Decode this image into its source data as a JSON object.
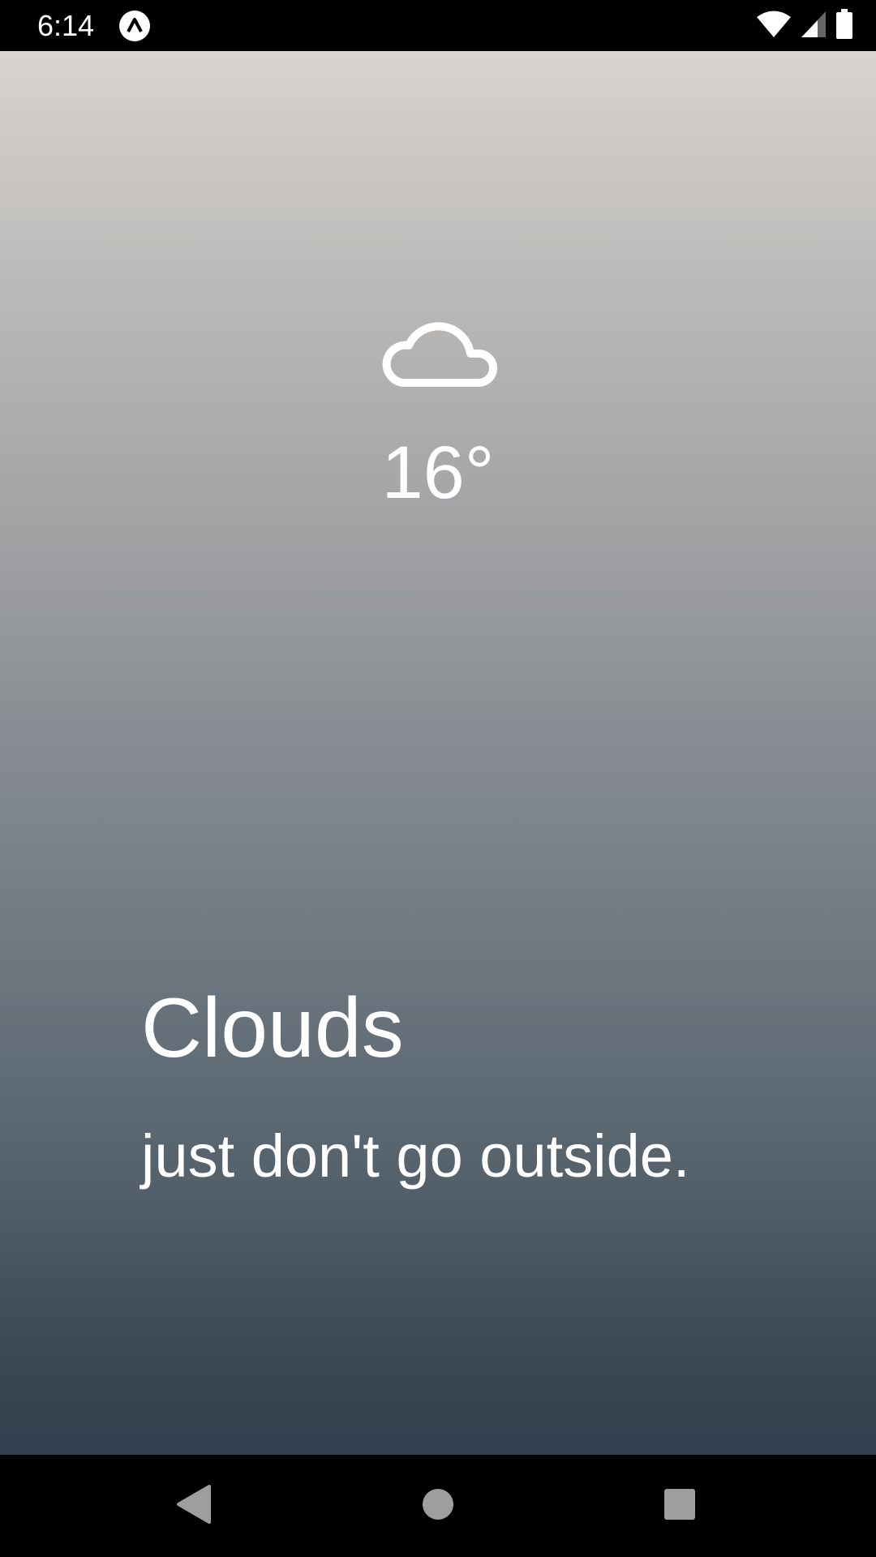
{
  "status_bar": {
    "time": "6:14",
    "icons": [
      "app-notification-icon",
      "wifi-icon",
      "signal-icon",
      "battery-icon"
    ]
  },
  "weather": {
    "icon": "cloud-icon",
    "temperature": "16°",
    "condition": "Clouds",
    "message": "just don't go outside."
  },
  "nav_bar": {
    "buttons": [
      "back-icon",
      "home-icon",
      "recents-icon"
    ]
  },
  "colors": {
    "gradient_top": "#d8d4cf",
    "gradient_bottom": "#303f4d",
    "text": "#ffffff",
    "system_bars": "#000000"
  }
}
